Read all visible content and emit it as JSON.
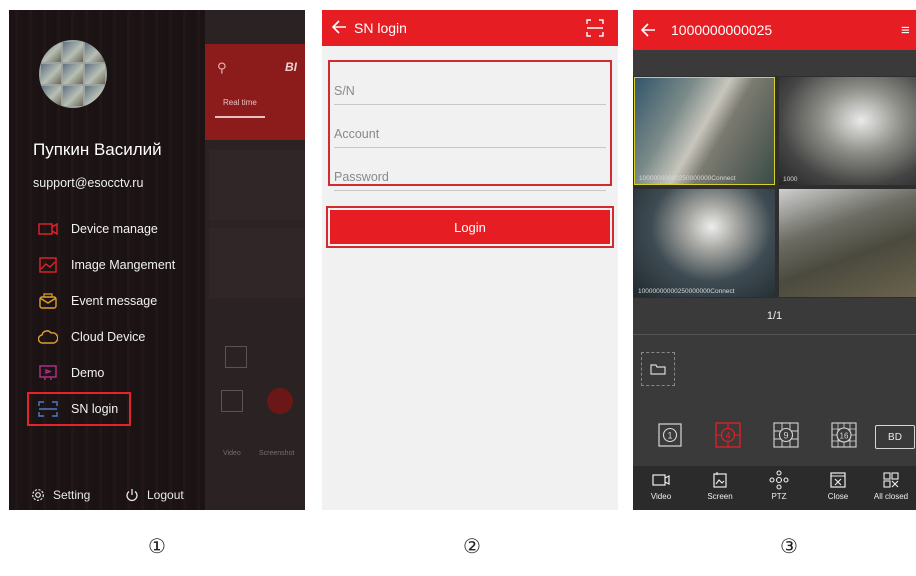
{
  "panel1": {
    "user_name": "Пупкин Василий",
    "email": "support@esocctv.ru",
    "menu": [
      {
        "label": "Device manage",
        "icon": "device-manage-icon"
      },
      {
        "label": "Image Mangement",
        "icon": "image-management-icon"
      },
      {
        "label": "Event message",
        "icon": "event-message-icon"
      },
      {
        "label": "Cloud Device",
        "icon": "cloud-device-icon"
      },
      {
        "label": "Demo",
        "icon": "demo-icon"
      },
      {
        "label": "SN login",
        "icon": "sn-login-icon",
        "highlighted": true
      }
    ],
    "setting_label": "Setting",
    "logout_label": "Logout",
    "background": {
      "brand": "BI",
      "tab_label": "Real time",
      "video_label": "Video",
      "screenshot_label": "Screenshot"
    }
  },
  "panel2": {
    "title": "SN login",
    "sn_placeholder": "S/N",
    "account_placeholder": "Account",
    "password_placeholder": "Password",
    "login_label": "Login"
  },
  "panel3": {
    "title": "1000000000025",
    "camera_captions": [
      "10000000000250000000Connect",
      "1000",
      "10000000000250000000Connect",
      ""
    ],
    "page_indicator": "1/1",
    "split_labels": [
      "1",
      "4",
      "9",
      "16"
    ],
    "bd_label": "BD",
    "toolbar": [
      {
        "label": "Video",
        "icon": "video-icon"
      },
      {
        "label": "Screen",
        "icon": "screenshot-icon"
      },
      {
        "label": "PTZ",
        "icon": "ptz-icon"
      },
      {
        "label": "Close",
        "icon": "close-window-icon"
      },
      {
        "label": "All closed",
        "icon": "all-closed-icon"
      }
    ]
  },
  "step_markers": [
    "①",
    "②",
    "③"
  ],
  "colors": {
    "accent": "#e61e24",
    "highlight_border": "#d12a2f",
    "drawer_bg": "#1b1314",
    "live_bg": "#3a3a3a"
  }
}
